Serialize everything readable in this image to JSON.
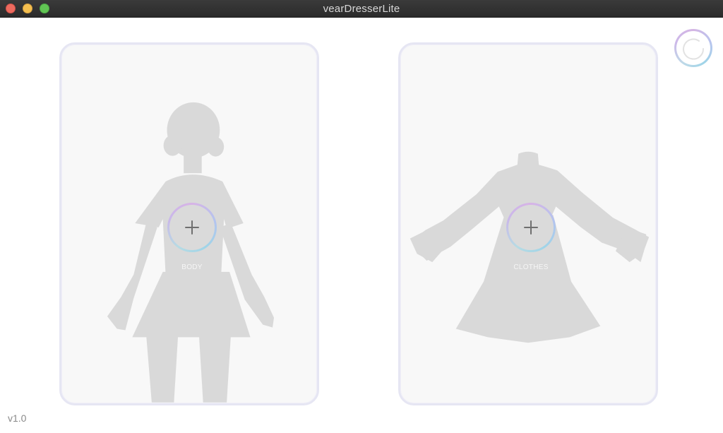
{
  "window": {
    "title": "vearDresserLite"
  },
  "panels": {
    "body": {
      "label": "BODY",
      "add_icon": "plus-icon",
      "silhouette": "body-silhouette"
    },
    "clothes": {
      "label": "CLOTHES",
      "add_icon": "plus-icon",
      "silhouette": "dress-silhouette"
    }
  },
  "toolbar": {
    "refresh_icon": "refresh-icon"
  },
  "footer": {
    "version": "v1.0"
  },
  "colors": {
    "panel_bg": "#f8f8f8",
    "panel_border": "#e6e6f3",
    "silhouette": "#d9d9d9",
    "ring_gradient": [
      "#d7b3e6",
      "#b4c3ef",
      "#9fd4e8"
    ]
  }
}
